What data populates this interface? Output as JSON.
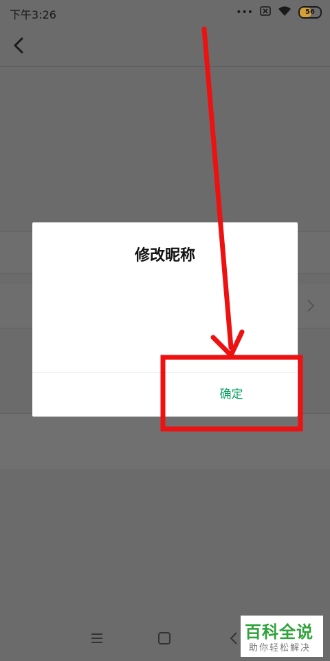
{
  "status_bar": {
    "time": "下午3:26",
    "more": "•••",
    "battery_level": "56",
    "battery_fraction": 0.56
  },
  "dialog": {
    "title": "修改昵称",
    "confirm_label": "确定"
  },
  "watermark": {
    "main": "百科全说",
    "sub": "助你轻松解决"
  },
  "colors": {
    "overlay": "#6b6b6b",
    "confirm_text": "#07a05f",
    "annotation_red": "#ee1111",
    "watermark_green": "#2fa23a"
  },
  "icons": {
    "back": "chevron-left-icon",
    "chevron": "chevron-right-icon",
    "wifi": "wifi-icon",
    "sim": "sim-off-icon",
    "battery": "battery-icon",
    "nav_menu": "menu-icon",
    "nav_home": "home-icon",
    "nav_back": "back-icon"
  }
}
